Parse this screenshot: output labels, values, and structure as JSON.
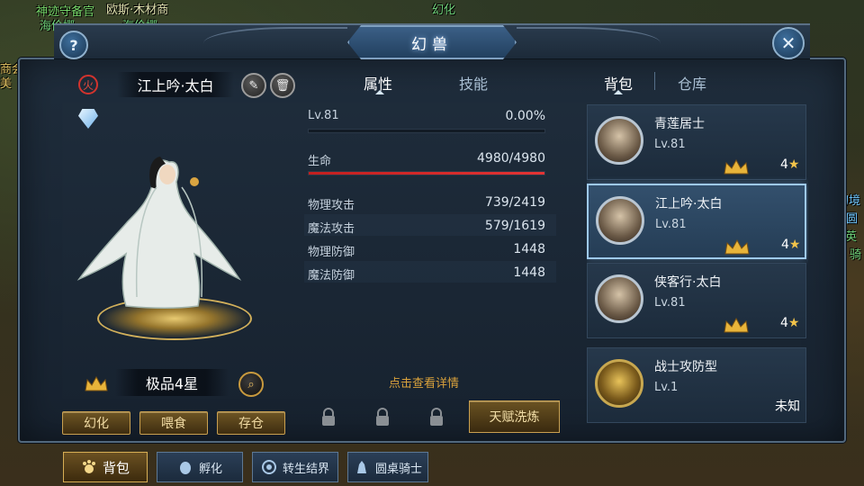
{
  "world": {
    "labels": [
      "神迹守备官",
      "欧斯·木材商",
      "海伦娜",
      "海伦娜",
      "幻化",
      "商会",
      "美",
      "幻境",
      "圆",
      "精英",
      "骑"
    ]
  },
  "window": {
    "title": "幻兽"
  },
  "left": {
    "element_badge": "火",
    "pet_name": "江上吟·太白",
    "quality": "极品4星",
    "buttons": {
      "transform": "幻化",
      "feed": "喂食",
      "store": "存仓"
    }
  },
  "middle": {
    "tabs": {
      "attributes": "属性",
      "skills": "技能"
    },
    "level_label": "Lv.81",
    "exp_percent": "0.00%",
    "exp_fraction": 0.0,
    "hp_label": "生命",
    "hp_value": "4980/4980",
    "hp_fraction": 1.0,
    "stats": [
      {
        "label": "物理攻击",
        "value": "739/2419"
      },
      {
        "label": "魔法攻击",
        "value": "579/1619"
      },
      {
        "label": "物理防御",
        "value": "1448"
      },
      {
        "label": "魔法防御",
        "value": "1448"
      }
    ],
    "detail_hint": "点击查看详情",
    "talent_button": "天赋洗炼"
  },
  "right": {
    "tabs": {
      "bag": "背包",
      "storage": "仓库"
    },
    "pets": [
      {
        "name": "青莲居士",
        "level": "Lv.81",
        "stars": "4",
        "selected": false,
        "kind": "scholar"
      },
      {
        "name": "江上吟·太白",
        "level": "Lv.81",
        "stars": "4",
        "selected": true,
        "kind": "scholar"
      },
      {
        "name": "侠客行·太白",
        "level": "Lv.81",
        "stars": "4",
        "selected": false,
        "kind": "scholar"
      },
      {
        "name": "战士攻防型",
        "level": "Lv.1",
        "stars": "未知",
        "selected": false,
        "kind": "armor"
      }
    ]
  },
  "bottom_nav": {
    "bag": "背包",
    "hatch": "孵化",
    "rebirth": "转生结界",
    "round_table": "圆桌骑士"
  },
  "colors": {
    "accent_gold": "#c9a050",
    "hp_red": "#e33434",
    "selected_border": "#9ec9f0"
  }
}
